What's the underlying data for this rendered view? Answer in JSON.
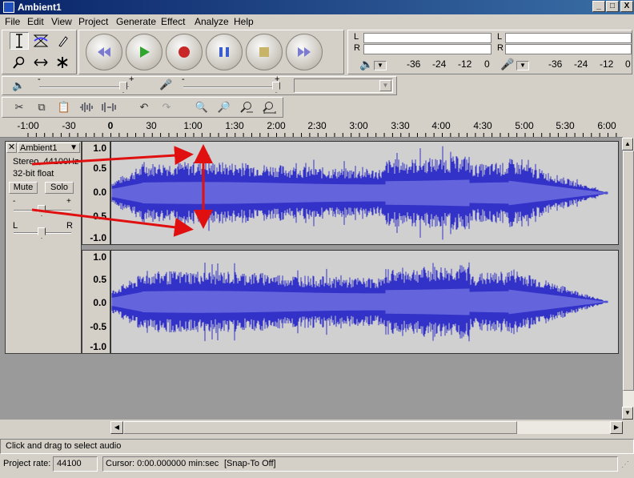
{
  "window": {
    "title": "Ambient1"
  },
  "window_buttons": {
    "minimize": "_",
    "maximize": "□",
    "close": "X"
  },
  "menu": [
    "File",
    "Edit",
    "View",
    "Project",
    "Generate",
    "Effect",
    "Analyze",
    "Help"
  ],
  "meters": {
    "channels": [
      "L",
      "R"
    ],
    "scale": [
      "-36",
      "-24",
      "-12",
      "0"
    ]
  },
  "mixer": {
    "minus": "-",
    "plus": "+"
  },
  "timeline": {
    "ticks": [
      "-1:00",
      "-30",
      "0",
      "30",
      "1:00",
      "1:30",
      "2:00",
      "2:30",
      "3:00",
      "3:30",
      "4:00",
      "4:30",
      "5:00",
      "5:30",
      "6:00"
    ]
  },
  "track": {
    "name": "Ambient1",
    "format": "Stereo, 44100Hz",
    "bitdepth": "32-bit float",
    "mute_label": "Mute",
    "solo_label": "Solo",
    "gain_minus": "-",
    "gain_plus": "+",
    "pan_left": "L",
    "pan_right": "R",
    "scale_labels": [
      "1.0",
      "0.5",
      "0.0",
      "-0.5",
      "-1.0"
    ]
  },
  "status": {
    "hint": "Click and drag to select audio",
    "project_rate_label": "Project rate:",
    "project_rate": "44100",
    "cursor": "Cursor: 0:00.000000 min:sec",
    "snap": "[Snap-To Off]"
  },
  "colors": {
    "waveform": "#3232c8",
    "waveform_rms": "#6464dc",
    "annotation": "#e01010"
  }
}
